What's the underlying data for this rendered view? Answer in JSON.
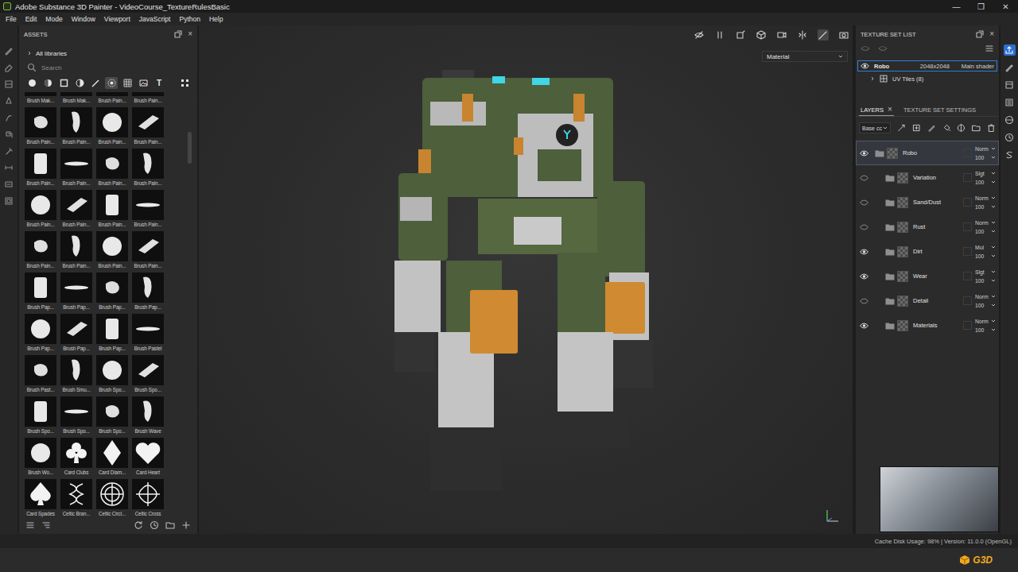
{
  "window": {
    "title": "Adobe Substance 3D Painter - VideoCourse_TextureRulesBasic",
    "controls": [
      "—",
      "❐",
      "✕"
    ]
  },
  "menu": [
    "File",
    "Edit",
    "Mode",
    "Window",
    "Viewport",
    "JavaScript",
    "Python",
    "Help"
  ],
  "assets": {
    "title": "ASSETS",
    "close": "×",
    "library": "All libraries",
    "search": {
      "placeholder": "Search"
    },
    "filters": [
      {
        "kind": "sphere",
        "label": "",
        "selected": false
      },
      {
        "kind": "half-sphere",
        "label": "",
        "selected": false
      },
      {
        "kind": "square",
        "label": "",
        "selected": false
      },
      {
        "kind": "circle-half",
        "label": "",
        "selected": false
      },
      {
        "kind": "brush",
        "label": "",
        "selected": false
      },
      {
        "kind": "pattern",
        "label": "",
        "selected": true
      },
      {
        "kind": "grid",
        "label": "",
        "selected": false
      },
      {
        "kind": "image",
        "label": "",
        "selected": false
      },
      {
        "kind": "text",
        "label": "T",
        "selected": false
      },
      {
        "kind": "all",
        "label": "",
        "selected": false
      }
    ],
    "items": [
      {
        "label": "Brush Mak...",
        "kind": "blob"
      },
      {
        "label": "Brush Mak...",
        "kind": "blob"
      },
      {
        "label": "Brush Pain...",
        "kind": "blob"
      },
      {
        "label": "Brush Pain...",
        "kind": "blob"
      },
      {
        "label": "Brush Pain...",
        "kind": "blob"
      },
      {
        "label": "Brush Pain...",
        "kind": "blob"
      },
      {
        "label": "Brush Pain...",
        "kind": "blob"
      },
      {
        "label": "Brush Pain...",
        "kind": "blob"
      },
      {
        "label": "Brush Pain...",
        "kind": "blob"
      },
      {
        "label": "Brush Pain...",
        "kind": "blob"
      },
      {
        "label": "Brush Pain...",
        "kind": "blob"
      },
      {
        "label": "Brush Pain...",
        "kind": "blob"
      },
      {
        "label": "Brush Pain...",
        "kind": "blob"
      },
      {
        "label": "Brush Pain...",
        "kind": "blob"
      },
      {
        "label": "Brush Pain...",
        "kind": "blob"
      },
      {
        "label": "Brush Pain...",
        "kind": "blob"
      },
      {
        "label": "Brush Pain...",
        "kind": "blob"
      },
      {
        "label": "Brush Pain...",
        "kind": "blob"
      },
      {
        "label": "Brush Pain...",
        "kind": "blob"
      },
      {
        "label": "Brush Pain...",
        "kind": "blob"
      },
      {
        "label": "Brush Pap...",
        "kind": "blob"
      },
      {
        "label": "Brush Pap...",
        "kind": "blob"
      },
      {
        "label": "Brush Pap...",
        "kind": "blob"
      },
      {
        "label": "Brush Pap...",
        "kind": "blob"
      },
      {
        "label": "Brush Pap...",
        "kind": "blob"
      },
      {
        "label": "Brush Pap...",
        "kind": "blob"
      },
      {
        "label": "Brush Pap...",
        "kind": "blob"
      },
      {
        "label": "Brush Pastel",
        "kind": "blob"
      },
      {
        "label": "Brush Past...",
        "kind": "blob"
      },
      {
        "label": "Brush Smu...",
        "kind": "blob"
      },
      {
        "label": "Brush Spo...",
        "kind": "blob"
      },
      {
        "label": "Brush Spo...",
        "kind": "blob"
      },
      {
        "label": "Brush Spo...",
        "kind": "blob"
      },
      {
        "label": "Brush Spo...",
        "kind": "blob"
      },
      {
        "label": "Brush Spo...",
        "kind": "blob"
      },
      {
        "label": "Brush Wave",
        "kind": "blob"
      },
      {
        "label": "Brush Wo...",
        "kind": "blob"
      },
      {
        "label": "Card Clubs",
        "kind": "club"
      },
      {
        "label": "Card Diam...",
        "kind": "diamond"
      },
      {
        "label": "Card Heart",
        "kind": "heart"
      },
      {
        "label": "Card Spades",
        "kind": "spade"
      },
      {
        "label": "Celtic Bran...",
        "kind": "knot"
      },
      {
        "label": "Celtic Circl...",
        "kind": "circle-knot"
      },
      {
        "label": "Celtic Cross",
        "kind": "cross-knot"
      }
    ]
  },
  "viewport": {
    "mode": "Material"
  },
  "texture_set_list": {
    "title": "TEXTURE SET LIST",
    "close": "×",
    "sets": [
      {
        "name": "Robo",
        "size": "2048x2048",
        "shader": "Main shader",
        "selected": true,
        "uv_tiles": "UV Tiles (8)"
      }
    ]
  },
  "layers": {
    "tabs": [
      {
        "label": "LAYERS",
        "selected": true,
        "close": "×"
      },
      {
        "label": "TEXTURE SET SETTINGS",
        "selected": false,
        "close": ""
      }
    ],
    "channel": "Base cc",
    "rows": [
      {
        "name": "Robo",
        "blend": "Norm",
        "opacity": "100",
        "visible": true,
        "selected": true,
        "nested": false
      },
      {
        "name": "Variation",
        "blend": "Slgt",
        "opacity": "100",
        "visible": false,
        "selected": false,
        "nested": true
      },
      {
        "name": "Sand/Dust",
        "blend": "Norm",
        "opacity": "100",
        "visible": false,
        "selected": false,
        "nested": true
      },
      {
        "name": "Rust",
        "blend": "Norm",
        "opacity": "100",
        "visible": false,
        "selected": false,
        "nested": true
      },
      {
        "name": "Dirt",
        "blend": "Mul",
        "opacity": "100",
        "visible": true,
        "selected": false,
        "nested": true
      },
      {
        "name": "Wear",
        "blend": "Slgt",
        "opacity": "100",
        "visible": true,
        "selected": false,
        "nested": true
      },
      {
        "name": "Detail",
        "blend": "Norm",
        "opacity": "100",
        "visible": false,
        "selected": false,
        "nested": true
      },
      {
        "name": "Materials",
        "blend": "Norm",
        "opacity": "100",
        "visible": true,
        "selected": false,
        "nested": true
      }
    ]
  },
  "status_bar": {
    "text": "Cache Disk Usage: 98% | Version: 11.0.0 (OpenGL)"
  },
  "logo": "G3D"
}
